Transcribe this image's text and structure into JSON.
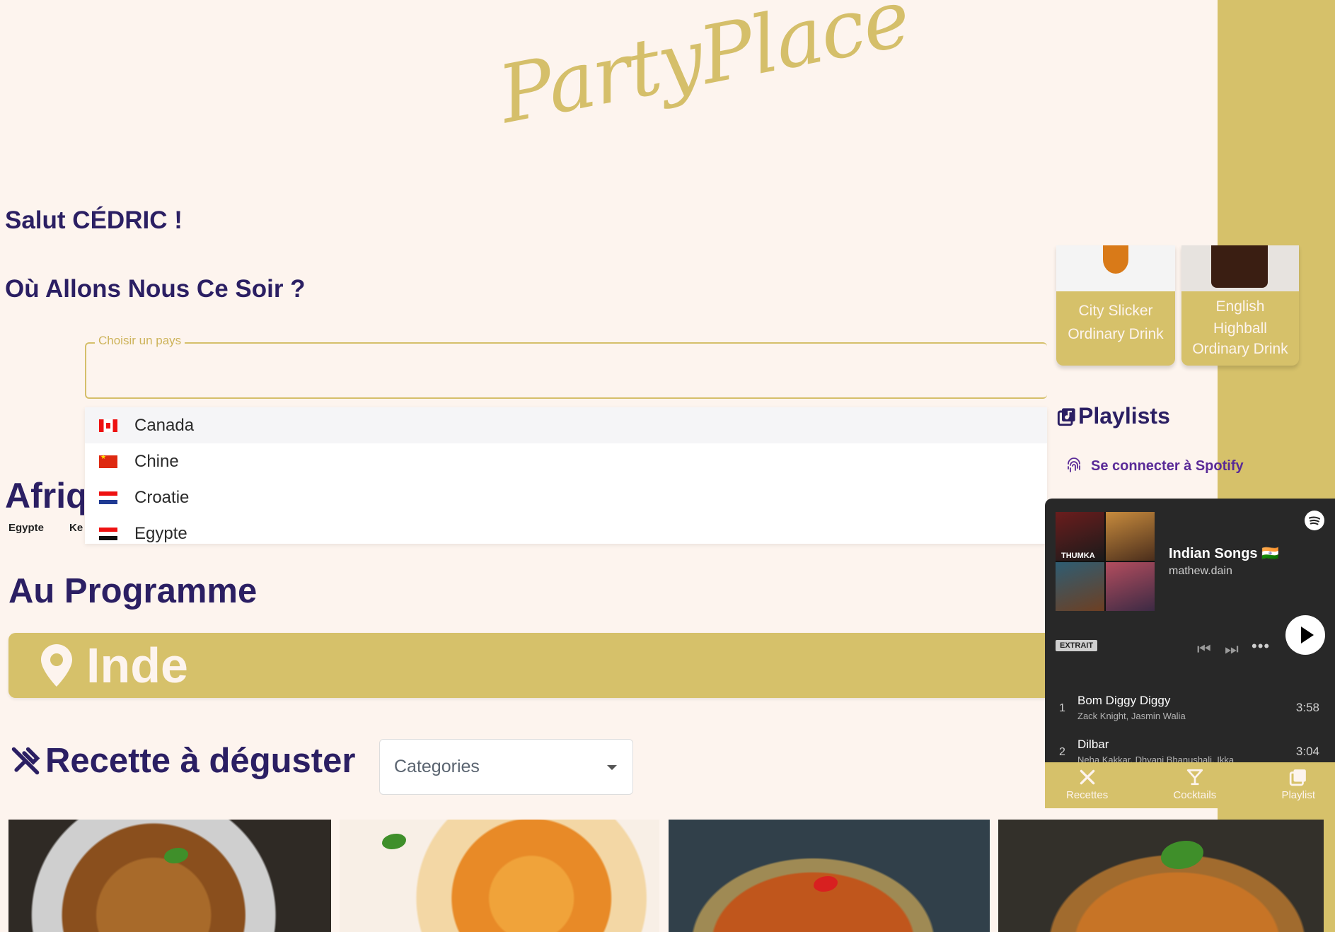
{
  "brand": {
    "logo": "PartyPlace"
  },
  "greeting": "Salut CÉDRIC !",
  "question": "Où Allons Nous Ce Soir ?",
  "country_select": {
    "label": "Choisir un pays",
    "value": "",
    "options": [
      {
        "name": "Canada",
        "flag": "canada-flag-icon",
        "highlighted": true
      },
      {
        "name": "Chine",
        "flag": "china-flag-icon"
      },
      {
        "name": "Croatie",
        "flag": "croatia-flag-icon"
      },
      {
        "name": "Egypte",
        "flag": "egypt-flag-icon"
      }
    ]
  },
  "continent_peek": {
    "title": "Afriq",
    "countries": [
      "Egypte",
      "Ke"
    ]
  },
  "programme": {
    "title": "Au Programme",
    "destination": "Inde"
  },
  "recipes": {
    "title": "Recette à déguster",
    "category_placeholder": "Categories"
  },
  "cocktails": [
    {
      "name": "City Slicker",
      "category": "Ordinary Drink"
    },
    {
      "name": "English Highball",
      "category": "Ordinary Drink"
    }
  ],
  "playlists": {
    "title": "Playlists",
    "connect_label": "Se connecter à Spotify"
  },
  "player": {
    "title": "Indian Songs 🇮🇳",
    "owner": "mathew.dain",
    "badge": "EXTRAIT",
    "cover_label": "THUMKA",
    "tracks": [
      {
        "num": "1",
        "name": "Bom Diggy Diggy",
        "artists": "Zack Knight, Jasmin Walia",
        "duration": "3:58"
      },
      {
        "num": "2",
        "name": "Dilbar",
        "artists": "Neha Kakkar, Dhvani Bhanushali, Ikka",
        "duration": "3:04"
      }
    ]
  },
  "bottom_nav": [
    {
      "label": "Recettes",
      "icon": "utensils-icon"
    },
    {
      "label": "Cocktails",
      "icon": "cocktail-icon"
    },
    {
      "label": "Playlist",
      "icon": "playlist-icon"
    }
  ],
  "colors": {
    "background": "#fdf4ee",
    "gold": "#d6c16a",
    "navy": "#2b1f63",
    "spotify_dark": "#282828"
  }
}
